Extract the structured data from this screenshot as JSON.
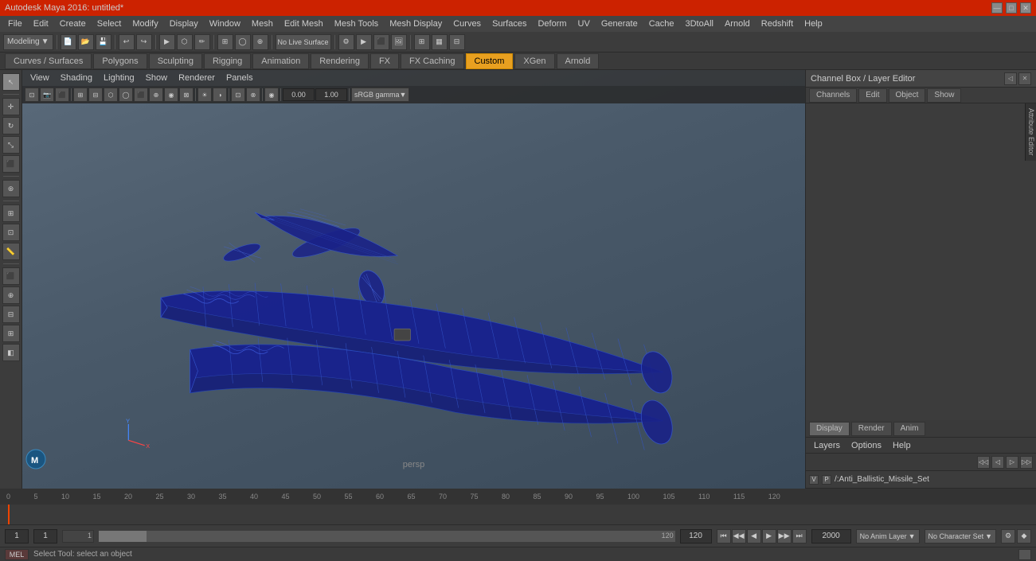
{
  "titlebar": {
    "title": "Autodesk Maya 2016: untitled*",
    "controls": [
      "—",
      "□",
      "✕"
    ]
  },
  "menubar": {
    "items": [
      "File",
      "Edit",
      "Create",
      "Select",
      "Modify",
      "Display",
      "Window",
      "Mesh",
      "Edit Mesh",
      "Mesh Tools",
      "Mesh Display",
      "Curves",
      "Surfaces",
      "Deform",
      "UV",
      "Generate",
      "Cache",
      "3DtoAll",
      "Arnold",
      "Redshift",
      "Help"
    ]
  },
  "toolbar1": {
    "workspace_label": "Modeling",
    "no_live_surface": "No Live Surface"
  },
  "tabs": {
    "items": [
      "Curves / Surfaces",
      "Polygons",
      "Sculpting",
      "Rigging",
      "Animation",
      "Rendering",
      "FX",
      "FX Caching",
      "Custom",
      "XGen",
      "Arnold"
    ],
    "active": "Custom"
  },
  "viewport": {
    "menubar_items": [
      "View",
      "Shading",
      "Lighting",
      "Show",
      "Renderer",
      "Panels"
    ],
    "toolbar_items": [
      "camera",
      "grid",
      "film",
      "scene"
    ],
    "input_value1": "0.00",
    "input_value2": "1.00",
    "gamma_label": "sRGB gamma",
    "camera_label": "persp"
  },
  "right_panel": {
    "header_title": "Channel Box / Layer Editor",
    "tabs": [
      "Channels",
      "Edit",
      "Object",
      "Show"
    ],
    "display_tabs": [
      "Display",
      "Render",
      "Anim"
    ],
    "active_display_tab": "Display",
    "layers_menu": [
      "Layers",
      "Options",
      "Help"
    ],
    "layer_name": "/:Anti_Ballistic_Missile_Set",
    "layer_v": "V",
    "layer_p": "P"
  },
  "timeline": {
    "ticks": [
      "0",
      "5",
      "10",
      "15",
      "20",
      "25",
      "30",
      "35",
      "40",
      "45",
      "50",
      "55",
      "60",
      "65",
      "70",
      "75",
      "80",
      "85",
      "90",
      "95",
      "100",
      "105",
      "110",
      "115",
      "120"
    ]
  },
  "bottombar": {
    "start_frame": "1",
    "current_frame": "1",
    "range_start": "1",
    "end_frame": "120",
    "range_end": "120",
    "max_frame": "2000",
    "anim_layer": "No Anim Layer",
    "char_set": "No Character Set",
    "play_buttons": [
      "⏮",
      "◀◀",
      "◀",
      "▶",
      "▶▶",
      "⏭"
    ]
  },
  "statusbar": {
    "mode": "MEL",
    "message": "Select Tool: select an object"
  }
}
